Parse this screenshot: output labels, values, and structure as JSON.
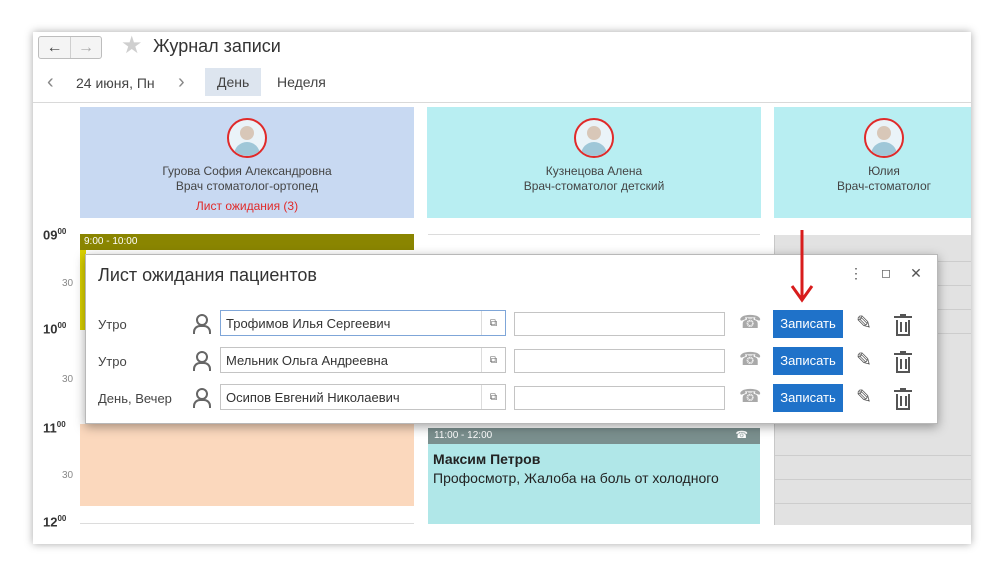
{
  "window": {
    "title": "Журнал записи",
    "nav": {
      "back_icon": "arrow-left-icon",
      "forward_icon": "arrow-right-icon"
    },
    "favorite_icon": "star-icon"
  },
  "date_nav": {
    "date": "24 июня, Пн",
    "tabs": [
      {
        "label": "День",
        "active": true
      },
      {
        "label": "Неделя",
        "active": false
      }
    ]
  },
  "doctors": [
    {
      "name": "Гурова София Александровна",
      "specialty": "Врач стоматолог-ортопед",
      "waitlist": "Лист ожидания (3)",
      "color": "#c8d9f2"
    },
    {
      "name": "Кузнецова Алена",
      "specialty": "Врач-стоматолог детский",
      "waitlist": "",
      "color": "#b8eef2"
    },
    {
      "name": "Юлия",
      "specialty": "Врач-стоматолог",
      "waitlist": "",
      "color": "#b8eef2"
    }
  ],
  "time_axis": {
    "hours": [
      {
        "h": "09",
        "m": "00"
      },
      {
        "h": "10",
        "m": "00"
      },
      {
        "h": "11",
        "m": "00"
      },
      {
        "h": "12",
        "m": "00"
      }
    ],
    "half": "30"
  },
  "appointments": [
    {
      "time": "9:00 - 10:00",
      "color": "#8a8500"
    },
    {
      "time": "11:00 - 12:00",
      "patient": "Максим Петров",
      "description": "Профосмотр, Жалоба на боль от холодного",
      "color": "#b0e7e8"
    }
  ],
  "modal": {
    "title": "Лист ожидания пациентов",
    "rows": [
      {
        "period": "Утро",
        "patient": "Трофимов Илья Сергеевич",
        "phone": "",
        "action": "Записать"
      },
      {
        "period": "Утро",
        "patient": "Мельник Ольга Андреевна",
        "phone": "",
        "action": "Записать"
      },
      {
        "period": "День, Вечер",
        "patient": "Осипов Евгений Николаевич",
        "phone": "",
        "action": "Записать"
      }
    ]
  },
  "colors": {
    "accent": "#1f72c9",
    "waitlist": "#e02a2a",
    "annotation_arrow": "#d81c1c"
  }
}
